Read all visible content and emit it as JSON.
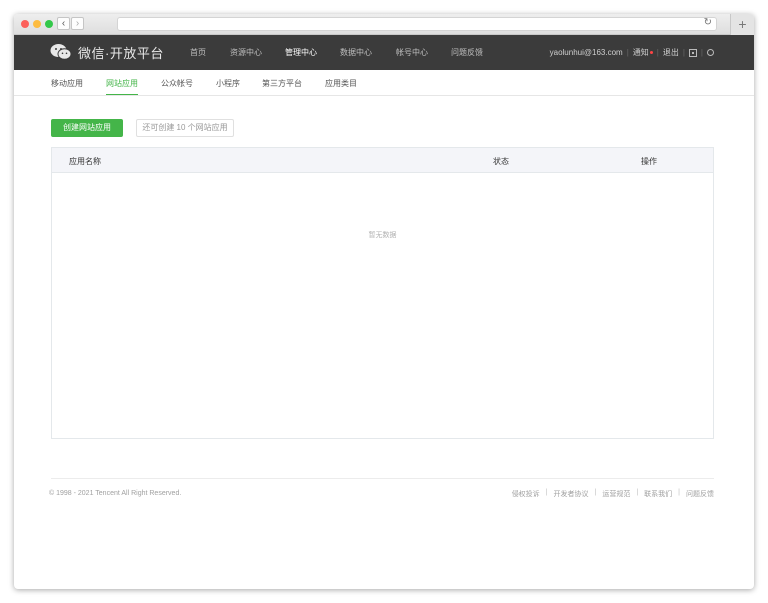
{
  "header": {
    "brand": "微信·开放平台",
    "nav": [
      "首页",
      "资源中心",
      "管理中心",
      "数据中心",
      "帐号中心",
      "问题反馈"
    ],
    "active_nav": "管理中心",
    "user_email": "yaolunhui@163.com",
    "notice": "通知",
    "logout": "退出"
  },
  "subnav": {
    "items": [
      "移动应用",
      "网站应用",
      "公众帐号",
      "小程序",
      "第三方平台",
      "应用类目"
    ],
    "active": "网站应用"
  },
  "actions": {
    "create_label": "创建网站应用",
    "quota_text": "还可创建 10 个网站应用"
  },
  "table": {
    "columns": [
      "应用名称",
      "状态",
      "操作"
    ],
    "empty_text": "暂无数据"
  },
  "footer": {
    "copyright": "© 1998 - 2021 Tencent All Right Reserved.",
    "links": [
      "侵权投诉",
      "开发者协议",
      "运营规范",
      "联系我们",
      "问题反馈"
    ]
  },
  "colors": {
    "accent": "#44b549",
    "topbar": "#3b3b3b"
  }
}
